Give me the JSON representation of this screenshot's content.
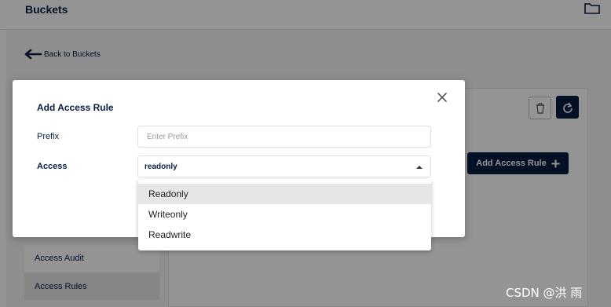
{
  "header": {
    "title": "Buckets",
    "folder_icon": "folder-icon"
  },
  "back_link": {
    "label": "Back to Buckets",
    "icon": "arrow-left-icon"
  },
  "toolbar": {
    "delete_icon": "trash-icon",
    "refresh_icon": "refresh-icon",
    "add_rule_label": "Add Access Rule",
    "add_rule_icon": "plus-icon"
  },
  "side_menu": {
    "items": [
      {
        "label": "Access Audit"
      },
      {
        "label": "Access Rules"
      }
    ]
  },
  "modal": {
    "title": "Add Access Rule",
    "close_icon": "close-icon",
    "prefix": {
      "label": "Prefix",
      "value": "",
      "placeholder": "Enter Prefix"
    },
    "access": {
      "label": "Access",
      "value": "readonly"
    },
    "options": [
      {
        "label": "Readonly"
      },
      {
        "label": "Writeonly"
      },
      {
        "label": "Readwrite"
      }
    ]
  },
  "watermark": "CSDN @洪 雨",
  "colors": {
    "brand_navy": "#081c42",
    "overlay": "#000000",
    "highlight": "#e6e6e6"
  }
}
